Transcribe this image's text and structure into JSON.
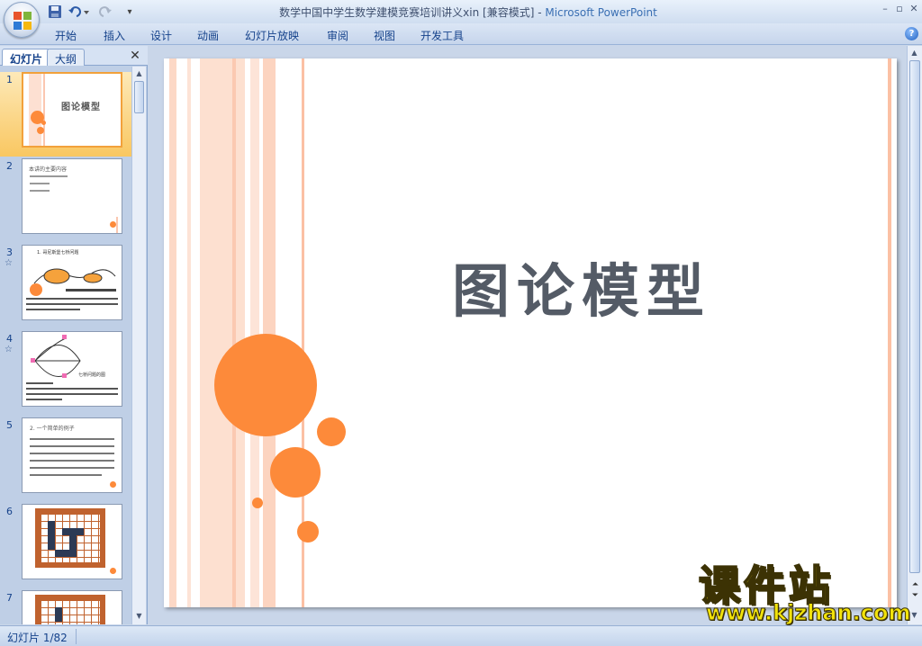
{
  "window": {
    "title": "数学中国中学生数学建模竞赛培训讲义xin [兼容模式] - ",
    "app_name": "Microsoft PowerPoint",
    "controls": [
      "–",
      "▫",
      "✕"
    ]
  },
  "ribbon": {
    "tabs": [
      "开始",
      "插入",
      "设计",
      "动画",
      "幻灯片放映",
      "审阅",
      "视图",
      "开发工具"
    ],
    "help": "?"
  },
  "panel": {
    "tabs": [
      "幻灯片",
      "大纲"
    ],
    "close": "✕",
    "thumbnails": [
      {
        "number": "1",
        "star": "",
        "title": "图论模型"
      },
      {
        "number": "2",
        "star": "",
        "title": "本讲的主要内容"
      },
      {
        "number": "3",
        "star": "☆",
        "title": "1. 哥尼斯堡七桥问题"
      },
      {
        "number": "4",
        "star": "☆",
        "title": "七桥问题的图"
      },
      {
        "number": "5",
        "star": "",
        "title": "2. 一个简单的例子"
      },
      {
        "number": "6",
        "star": "",
        "title": ""
      },
      {
        "number": "7",
        "star": "",
        "title": ""
      }
    ]
  },
  "slide": {
    "title": "图论模型",
    "accent_color": "#fd8a3a",
    "stripe_color": "#fbd9c9"
  },
  "status": {
    "slide_indicator": "幻灯片 1/82"
  },
  "watermark": {
    "text_cn": "课件站",
    "url": "www.kjzhan.com"
  }
}
